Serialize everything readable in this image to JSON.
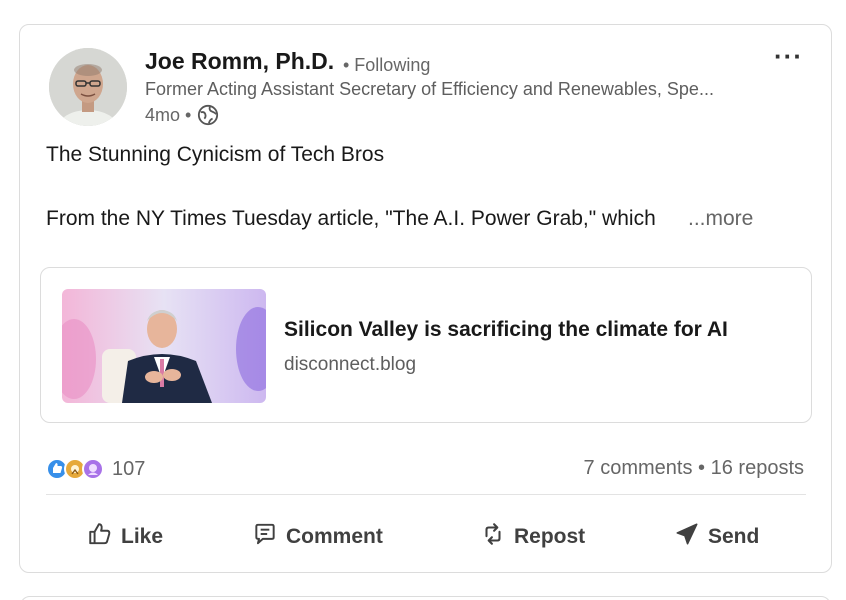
{
  "post": {
    "author": {
      "name": "Joe Romm, Ph.D.",
      "following": "• Following",
      "headline": "Former Acting Assistant Secretary of Efficiency and Renewables, Spe...",
      "time": "4mo •"
    },
    "text_line1": "The Stunning Cynicism of Tech Bros",
    "text_line2": "From the NY Times Tuesday article, \"The A.I. Power Grab,\" which",
    "more_label": "...more",
    "link": {
      "title": "Silicon Valley is sacrificing the climate for AI",
      "domain": "disconnect.blog"
    },
    "reactions_count": "107",
    "comments": "7 comments",
    "separator": " • ",
    "reposts": "16 reposts"
  },
  "actions": {
    "like": "Like",
    "comment": "Comment",
    "repost": "Repost",
    "send": "Send"
  },
  "icons": {
    "more": "ellipsis-icon",
    "visibility": "globe-icon",
    "like": "thumbs-up-icon",
    "comment": "comment-bubble-icon",
    "repost": "repost-arrows-icon",
    "send": "paper-plane-icon"
  },
  "colors": {
    "like_reaction": "#378fe9",
    "celebrate_reaction": "#e6a93b",
    "support_reaction": "#a872e8",
    "text_primary": "#191919",
    "text_secondary": "#666666"
  }
}
